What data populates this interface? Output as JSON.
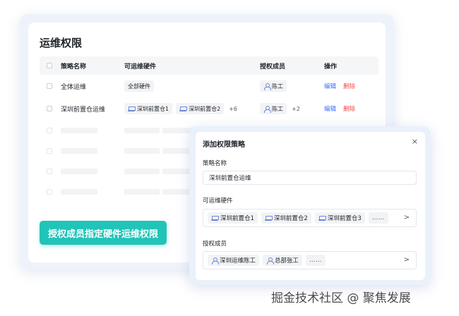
{
  "page": {
    "title": "运维权限"
  },
  "table": {
    "headers": [
      "策略名称",
      "可运维硬件",
      "授权成员",
      "操作"
    ],
    "rows": [
      {
        "name": "全体运维",
        "hardware": [
          "全部硬件"
        ],
        "hardware_more": "",
        "members": [
          "陈工"
        ],
        "members_more": "",
        "edit": "编辑",
        "delete": "删除"
      },
      {
        "name": "深圳前置仓运维",
        "hardware": [
          "深圳前置仓1",
          "深圳前置仓2"
        ],
        "hardware_more": "+6",
        "members": [
          "陈工"
        ],
        "members_more": "+2",
        "edit": "编辑",
        "delete": "删除"
      }
    ]
  },
  "banner": {
    "text": "授权成员指定硬件运维权限"
  },
  "modal": {
    "title": "添加权限策略",
    "close": "×",
    "name_label": "策略名称",
    "name_value": "深圳前置仓运维",
    "hardware_label": "可运维硬件",
    "hardware_tags": [
      "深圳前置仓1",
      "深圳前置仓2",
      "深圳前置仓3"
    ],
    "hardware_more": "……",
    "members_label": "授权成员",
    "member_tags": [
      "深圳运维陈工",
      "总部张工"
    ],
    "members_more": "……",
    "chevron": ">"
  },
  "watermark": {
    "text": "掘金技术社区 @ 聚焦发展"
  },
  "icons": {
    "hardware": "rack-icon",
    "member": "user-icon"
  },
  "colors": {
    "accent": "#3370ff",
    "danger": "#f54a45",
    "banner": "#21c4b8",
    "icon": "#6c87d9"
  }
}
